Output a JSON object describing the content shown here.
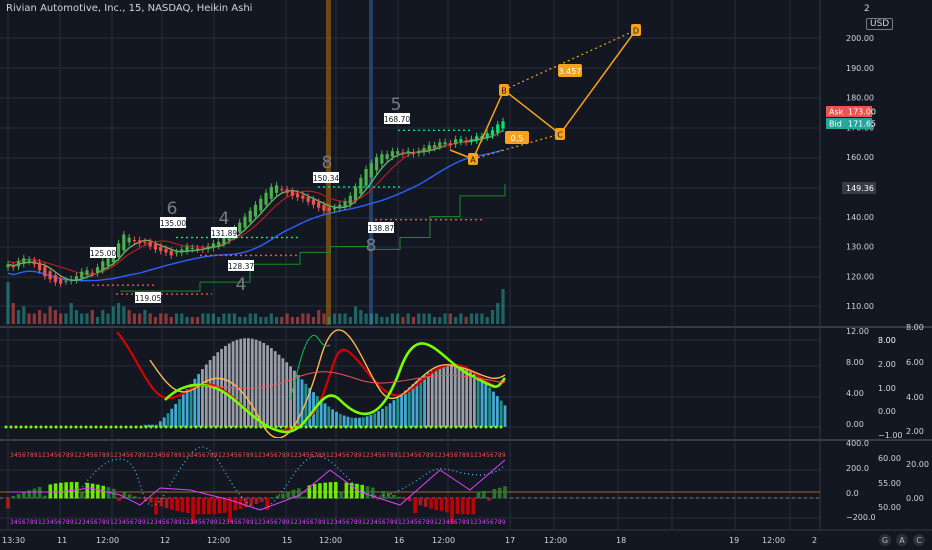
{
  "header": {
    "title": "Rivian Automotive, Inc., 15, NASDAQ, Heikin Ashi",
    "currency": "USD",
    "corner_label": "2"
  },
  "colors": {
    "background": "#131722",
    "grid": "#2a2e39",
    "bull": "#26a69a",
    "bull_bright": "#00e676",
    "bear": "#ef5350",
    "orange": "#f7a21b",
    "blue": "#2962ff",
    "volume_bull": "#26a69a",
    "volume_bear": "#ef5350",
    "ask": "#ef5350",
    "bid": "#26a69a"
  },
  "quote": {
    "ask_label": "Ask",
    "ask_value": "173.00",
    "bid_label": "Bid",
    "bid_value": "171.65",
    "last_price": "149.36"
  },
  "price_axis": [
    "200.00",
    "190.00",
    "180.00",
    "170.00",
    "160.00",
    "150.00",
    "140.00",
    "130.00",
    "120.00",
    "110.00"
  ],
  "pane2_axis_a": [
    "12.00",
    "8.00",
    "4.00",
    "0.00"
  ],
  "pane2_axis_b": [
    "8.00",
    "3.00",
    "2.00",
    "1.00",
    "0.00",
    "−1.00"
  ],
  "pane2_axis_c": [
    "6.00",
    "4.00",
    "2.00"
  ],
  "pane3_axis_a": [
    "400.0",
    "200.0",
    "0.0",
    "−200.0"
  ],
  "pane3_axis_b": [
    "60.00",
    "55.00",
    "50.00"
  ],
  "pane3_axis_c": [
    "20.00",
    "0.00"
  ],
  "time_axis": [
    "13:30",
    "11",
    "12:00",
    "12",
    "12:00",
    "15",
    "12:00",
    "16",
    "12:00",
    "17",
    "12:00",
    "18",
    "19",
    "12:00",
    "2"
  ],
  "corner_buttons": [
    "G",
    "A",
    "C"
  ],
  "annotations": {
    "price_labels": [
      "125.00",
      "135.00",
      "131.89",
      "128.37",
      "119.05",
      "150.34",
      "138.87",
      "168.70"
    ],
    "wave_counts": [
      "6",
      "4",
      "4",
      "8",
      "8",
      "5"
    ],
    "pattern_points": [
      "B",
      "D",
      "A",
      "C"
    ],
    "ratios": [
      "3.457",
      "0.5"
    ]
  },
  "chart_data": {
    "type": "candlestick",
    "title": "Rivian Automotive, Inc., 15, NASDAQ, Heikin Ashi",
    "ylim": [
      103,
      212
    ],
    "grid": true,
    "candles_close": [
      124,
      123,
      125,
      126,
      125.5,
      124,
      122,
      120,
      119,
      118,
      117.5,
      118.5,
      119,
      120,
      121.5,
      122,
      121,
      123,
      125,
      126,
      128,
      131,
      134,
      133,
      132,
      131,
      131.5,
      130,
      129,
      128.5,
      128,
      127,
      128,
      129,
      130,
      129.5,
      129,
      129,
      130,
      131,
      131.5,
      133,
      135,
      136,
      138,
      140,
      142,
      144,
      146,
      148,
      150,
      150.5,
      149,
      148,
      147,
      146.5,
      146,
      145,
      144,
      143,
      142,
      142,
      143,
      144,
      145,
      147,
      150,
      153,
      156,
      158,
      160,
      161,
      161,
      162,
      162,
      161,
      162,
      161,
      162,
      163,
      164,
      164,
      165,
      165,
      164,
      166,
      166,
      165,
      166,
      167,
      167,
      168,
      169,
      171,
      172
    ],
    "volume": [
      12,
      6,
      4,
      5,
      3,
      3,
      4,
      3,
      5,
      4,
      3,
      3,
      6,
      4,
      3,
      3,
      4,
      2,
      4,
      3,
      5,
      6,
      5,
      4,
      3,
      3,
      4,
      3,
      2,
      3,
      3,
      2,
      3,
      3,
      2,
      2,
      2,
      3,
      3,
      3,
      2,
      3,
      3,
      3,
      2,
      2,
      3,
      3,
      2,
      2,
      3,
      2,
      2,
      3,
      2,
      2,
      3,
      3,
      2,
      4,
      3,
      2,
      3,
      3,
      3,
      2,
      5,
      4,
      3,
      3,
      3,
      2,
      2,
      3,
      3,
      2,
      3,
      2,
      3,
      3,
      3,
      2,
      2,
      3,
      3,
      2,
      3,
      2,
      3,
      3,
      3,
      2,
      4,
      6,
      10
    ]
  }
}
